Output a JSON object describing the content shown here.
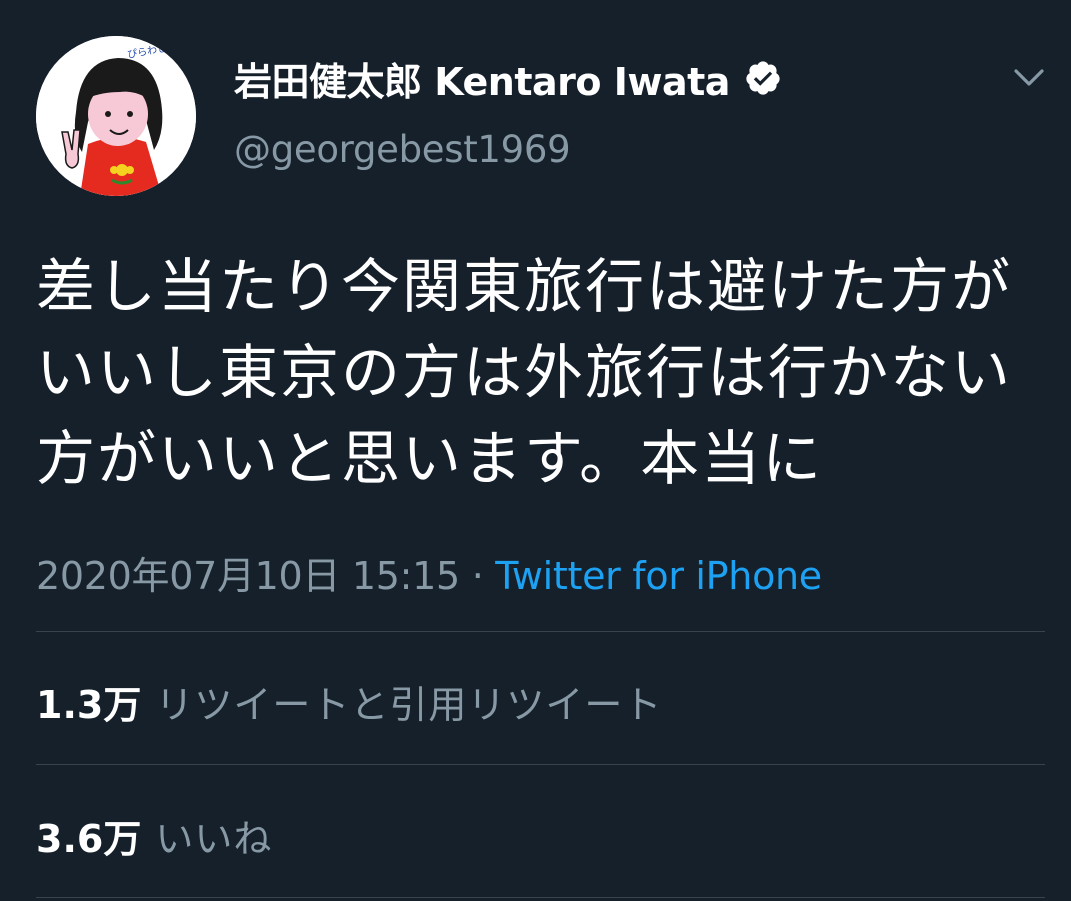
{
  "tweet": {
    "display_name": "岩田健太郎 Kentaro Iwata",
    "handle": "@georgebest1969",
    "verified_icon": "verified-badge-icon",
    "menu_icon": "chevron-down-icon",
    "avatar_caption": "ぴらわしまり",
    "text": "差し当たり今関東旅行は避けた方がいいし東京の方は外旅行は行かない方がいいと思います。本当に",
    "timestamp": "2020年07月10日 15:15",
    "separator": "·",
    "source": "Twitter for iPhone",
    "retweets": {
      "count": "1.3万",
      "label": "リツイートと引用リツイート"
    },
    "likes": {
      "count": "3.6万",
      "label": "いいね"
    }
  },
  "colors": {
    "background": "#15202b",
    "text": "#ffffff",
    "secondary_text": "#8899a6",
    "accent": "#1da1f2",
    "divider": "#38444d"
  }
}
